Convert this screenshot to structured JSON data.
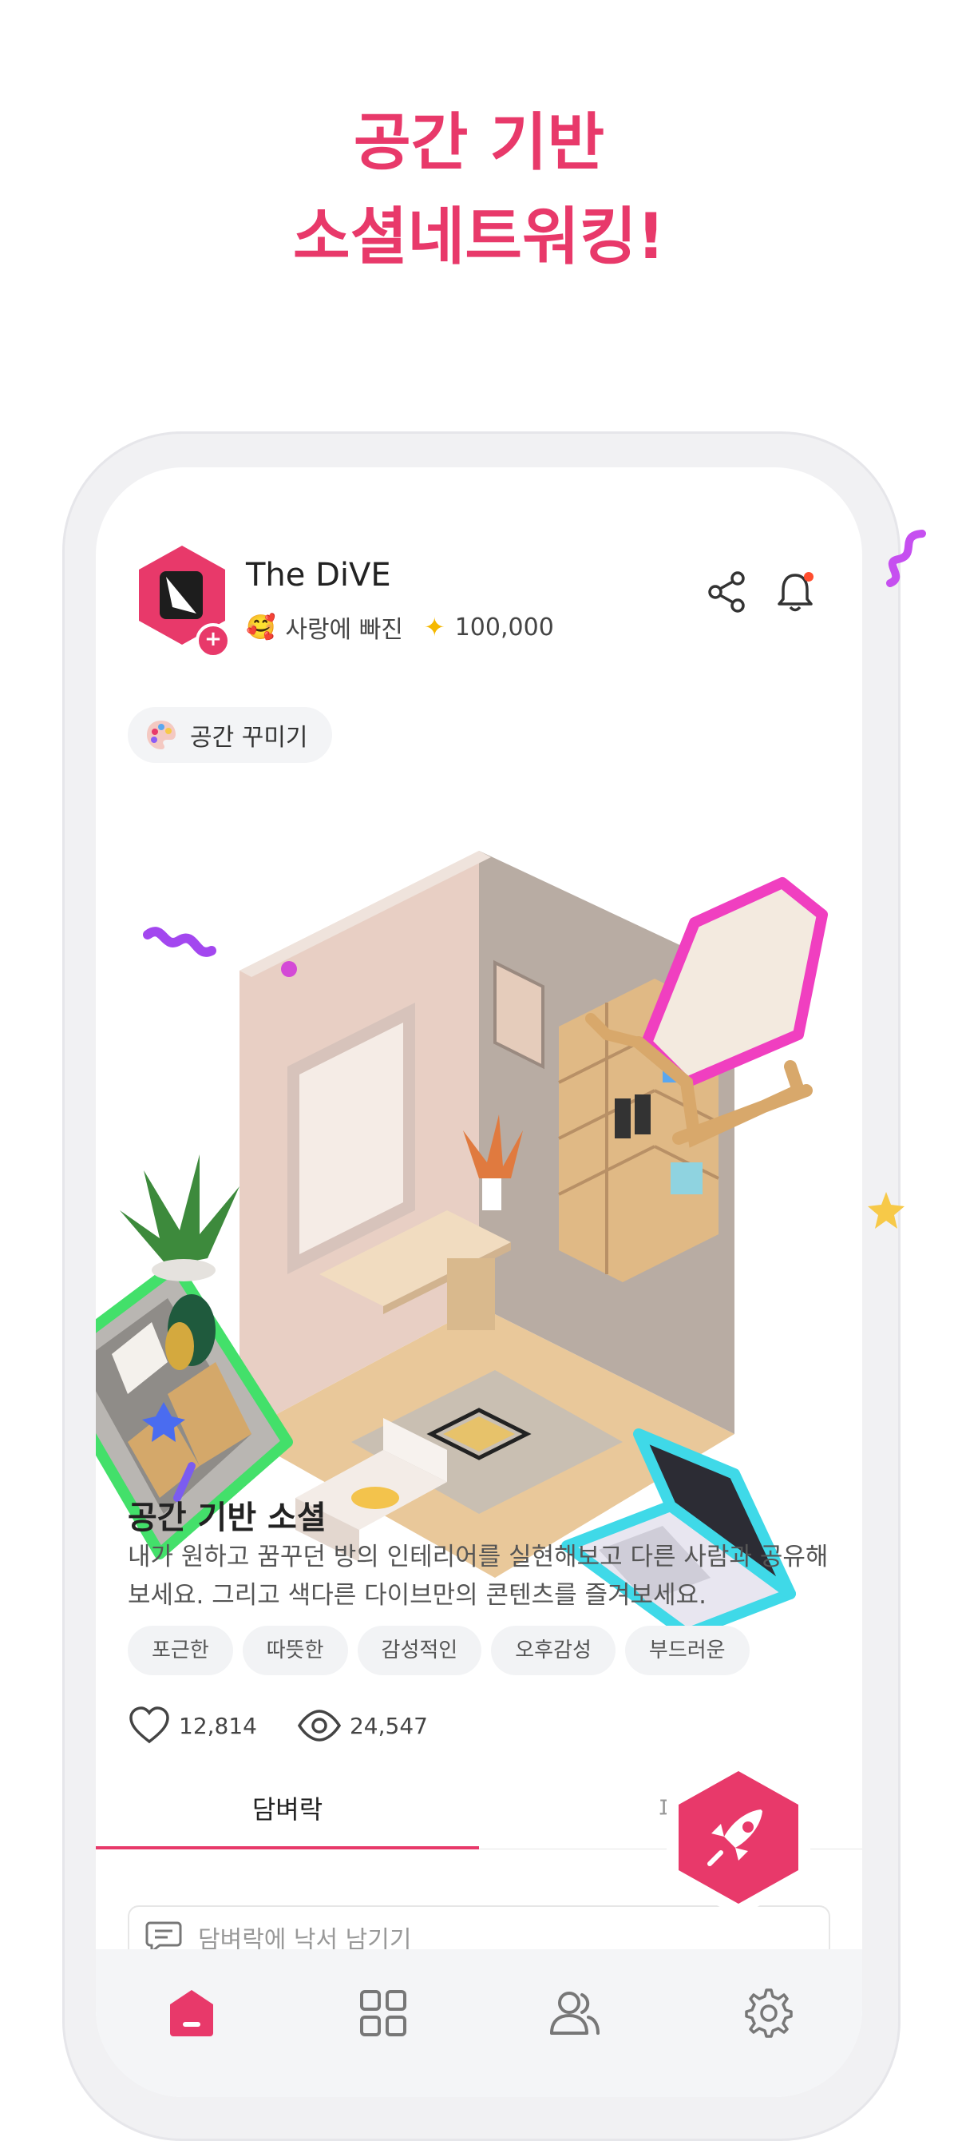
{
  "headline": {
    "line1": "공간 기반",
    "line2": "소셜네트워킹!"
  },
  "header": {
    "app_name": "The DiVE",
    "mood_emoji": "🥰",
    "mood_label": "사랑에 빠진",
    "points": "100,000",
    "icons": [
      "share-icon",
      "bell-icon"
    ]
  },
  "chip": {
    "label": "공간 꾸미기",
    "icon": "palette-icon"
  },
  "post": {
    "title": "공간 기반 소셜",
    "description": "내가 원하고 꿈꾸던 방의 인테리어를 실현해보고 다른 사람과 공유해 보세요. 그리고 색다른 다이브만의 콘텐츠를 즐겨보세요.",
    "tags": [
      "포근한",
      "따뜻한",
      "감성적인",
      "오후감성",
      "부드러운"
    ],
    "likes": "12,814",
    "views": "24,547"
  },
  "tabs": {
    "active": "담벼락",
    "second": "파"
  },
  "comment": {
    "placeholder": "담벼락에 낙서 남기기"
  },
  "nav": [
    "home-icon",
    "grid-icon",
    "friends-icon",
    "settings-icon"
  ],
  "colors": {
    "accent": "#e8396a",
    "text": "#222222"
  }
}
